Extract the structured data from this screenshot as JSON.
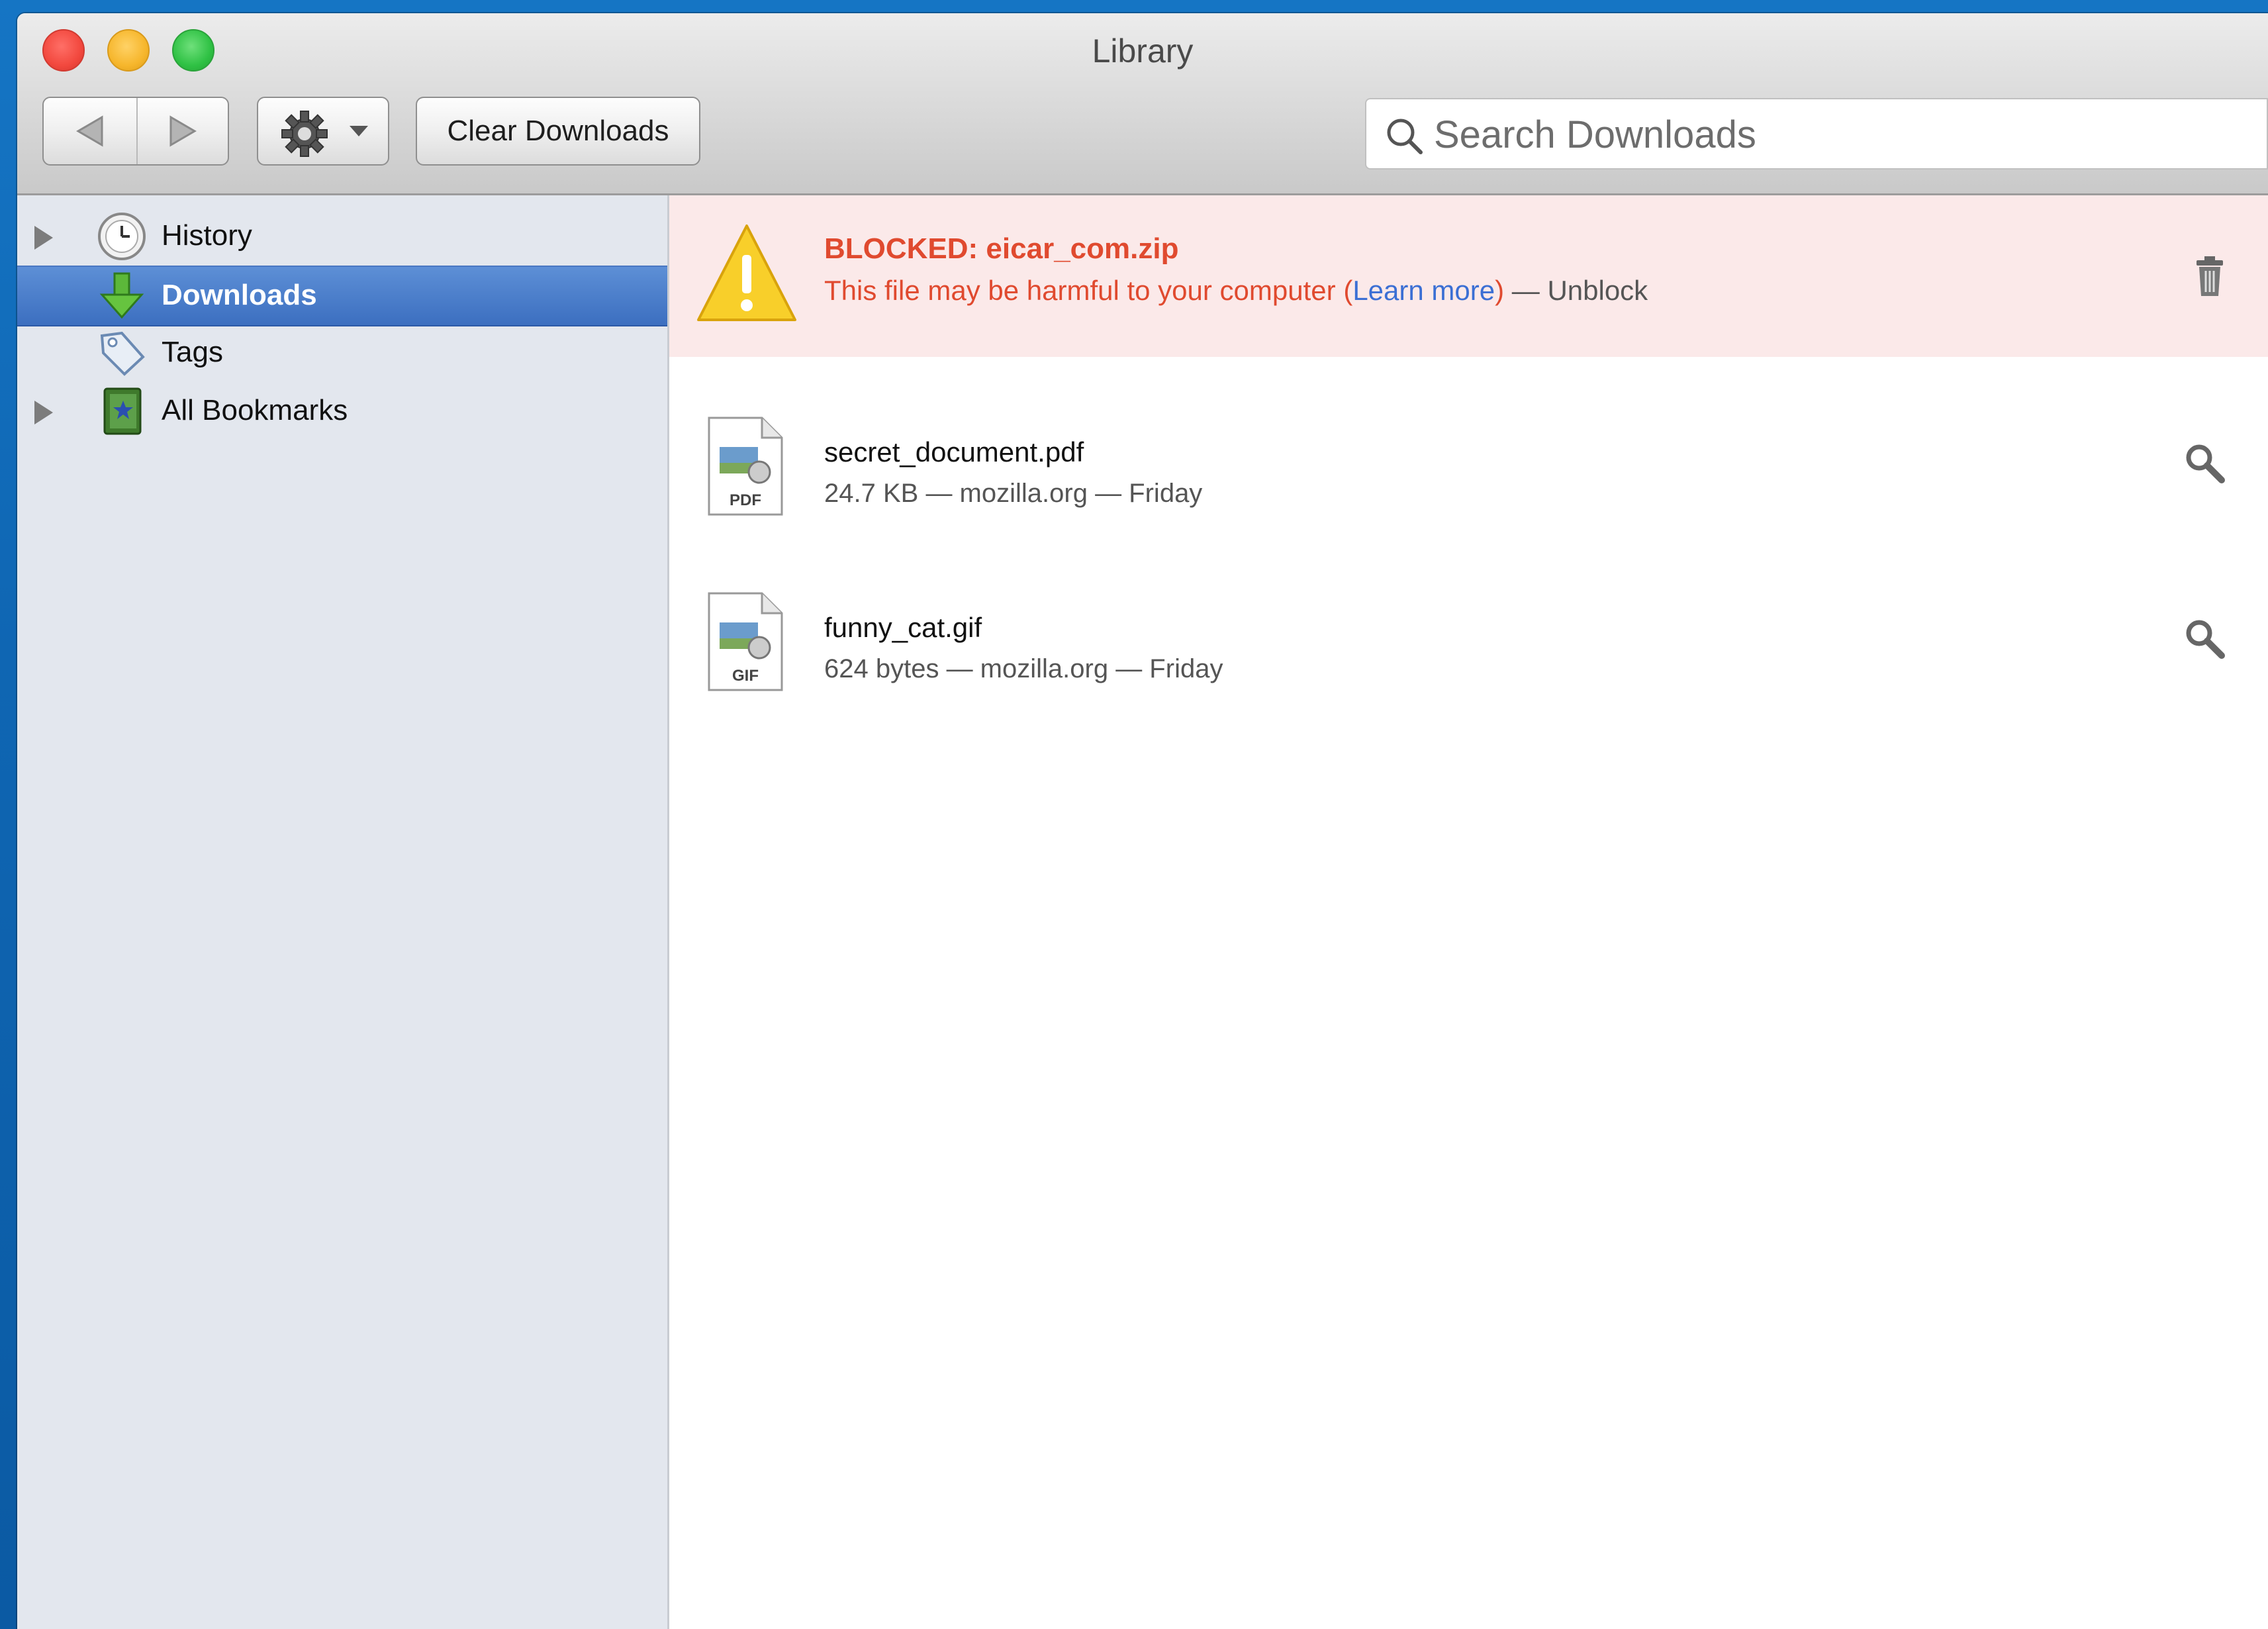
{
  "window": {
    "title": "Library"
  },
  "toolbar": {
    "clear_label": "Clear Downloads",
    "search_placeholder": "Search Downloads"
  },
  "sidebar": {
    "items": [
      {
        "label": "History",
        "icon": "clock-icon",
        "expandable": true,
        "selected": false
      },
      {
        "label": "Downloads",
        "icon": "download-arrow-icon",
        "expandable": false,
        "selected": true
      },
      {
        "label": "Tags",
        "icon": "tag-icon",
        "expandable": false,
        "selected": false
      },
      {
        "label": "All Bookmarks",
        "icon": "bookmarks-book-icon",
        "expandable": true,
        "selected": false
      }
    ]
  },
  "downloads": {
    "blocked": {
      "title": "BLOCKED: eicar_com.zip",
      "warning": "This file may be harmful to your computer",
      "open_paren": "(",
      "learn_more": "Learn more",
      "close_paren": ")",
      "separator": " — ",
      "unblock": "Unblock",
      "icon": "warning-triangle-icon",
      "action_icon": "trash-icon"
    },
    "items": [
      {
        "name": "secret_document.pdf",
        "meta": "24.7 KB — mozilla.org — Friday",
        "file_badge": "PDF",
        "action_icon": "magnifier-icon"
      },
      {
        "name": "funny_cat.gif",
        "meta": "624 bytes — mozilla.org — Friday",
        "file_badge": "GIF",
        "action_icon": "magnifier-icon"
      }
    ]
  },
  "colors": {
    "selection": "#3c6fc0",
    "blocked_text": "#e04a2f",
    "blocked_background": "#fbe9e9",
    "link": "#3b6fd4"
  }
}
